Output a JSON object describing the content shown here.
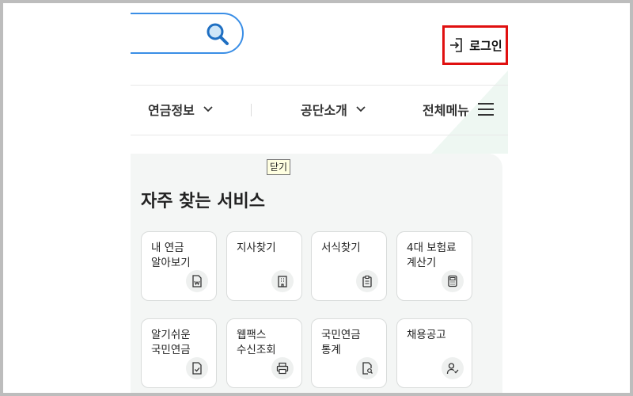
{
  "header": {
    "search": {
      "icon": "search-icon",
      "accent": "#3a8ee6"
    },
    "login": {
      "label": "로그인",
      "icon": "login-arrow-icon",
      "highlight": "#e01010"
    }
  },
  "nav": {
    "items": [
      {
        "label": "연금정보",
        "icon": "chevron-down-icon"
      },
      {
        "label": "공단소개",
        "icon": "chevron-down-icon"
      },
      {
        "label": "전체메뉴",
        "icon": "hamburger-menu-icon"
      }
    ]
  },
  "tooltip": {
    "text": "닫기"
  },
  "services": {
    "title": "자주 찾는 서비스",
    "cards": [
      {
        "label": "내 연금\n알아보기",
        "icon": "document-won-icon"
      },
      {
        "label": "지사찾기",
        "icon": "building-icon"
      },
      {
        "label": "서식찾기",
        "icon": "clipboard-icon"
      },
      {
        "label": "4대 보험료\n계산기",
        "icon": "calculator-icon"
      },
      {
        "label": "알기쉬운\n국민연금",
        "icon": "document-check-icon"
      },
      {
        "label": "웹팩스\n수신조회",
        "icon": "printer-icon"
      },
      {
        "label": "국민연금\n통계",
        "icon": "document-search-icon"
      },
      {
        "label": "채용공고",
        "icon": "person-check-icon"
      }
    ]
  }
}
